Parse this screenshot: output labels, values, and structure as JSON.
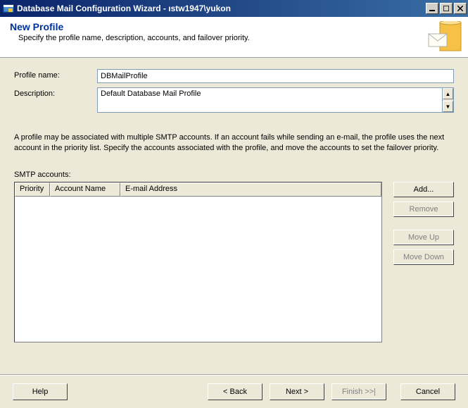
{
  "window": {
    "title": "Database Mail Configuration Wizard - ıstw1947\\yukon"
  },
  "header": {
    "title": "New Profile",
    "subtitle": "Specify the profile name, description, accounts, and failover priority."
  },
  "fields": {
    "profile_name_label": "Profile name:",
    "profile_name_value": "DBMailProfile",
    "description_label": "Description:",
    "description_value": "Default Database Mail Profile"
  },
  "info_text": "A profile may be associated with multiple SMTP accounts. If an account fails while sending an e-mail, the profile uses the next account in the priority list. Specify the accounts associated with the profile, and move the accounts to set the failover priority.",
  "accounts": {
    "label": "SMTP accounts:",
    "columns": {
      "priority": "Priority",
      "account_name": "Account Name",
      "email": "E-mail Address"
    },
    "rows": [],
    "buttons": {
      "add": "Add...",
      "remove": "Remove",
      "move_up": "Move Up",
      "move_down": "Move Down"
    }
  },
  "footer": {
    "help": "Help",
    "back": "< Back",
    "next": "Next >",
    "finish": "Finish >>|",
    "cancel": "Cancel"
  }
}
